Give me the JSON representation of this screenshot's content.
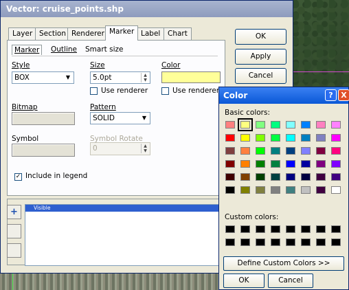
{
  "window": {
    "title": "Vector: cruise_points.shp"
  },
  "tabs": [
    "Layer",
    "Section",
    "Renderer",
    "Marker",
    "Label",
    "Chart"
  ],
  "subtabs": [
    "Marker",
    "Outline",
    "Smart size"
  ],
  "form": {
    "style_label": "Style",
    "style_value": "BOX",
    "size_label": "Size",
    "size_value": "5.0pt",
    "color_label": "Color",
    "color_value": "#ffff99",
    "use_renderer_label": "Use renderer",
    "use_renderer2_label": "Use renderer",
    "bitmap_label": "Bitmap",
    "pattern_label": "Pattern",
    "pattern_value": "SOLID",
    "symbol_label": "Symbol",
    "symbol_rotate_label": "Symbol Rotate",
    "symbol_rotate_value": "0",
    "include_legend_label": "Include in legend",
    "include_legend_checked": true
  },
  "buttons": {
    "ok": "OK",
    "apply": "Apply",
    "cancel": "Cancel"
  },
  "list": {
    "header": "Visible",
    "add_symbol": "+"
  },
  "color_dialog": {
    "title": "Color",
    "help_glyph": "?",
    "close_glyph": "X",
    "basic_label": "Basic colors:",
    "custom_label": "Custom colors:",
    "define_button": "Define Custom Colors >>",
    "ok": "OK",
    "cancel": "Cancel",
    "basic_colors": [
      [
        "#ff8080",
        "#ffff80",
        "#80ff80",
        "#00ff80",
        "#80ffff",
        "#0080ff",
        "#ff80c0",
        "#ff80ff"
      ],
      [
        "#ff0000",
        "#ffff00",
        "#80ff00",
        "#00ff40",
        "#00ffff",
        "#0080c0",
        "#8080c0",
        "#ff00ff"
      ],
      [
        "#804040",
        "#ff8040",
        "#00ff00",
        "#008080",
        "#004080",
        "#8080ff",
        "#800040",
        "#ff0080"
      ],
      [
        "#800000",
        "#ff8000",
        "#008000",
        "#008040",
        "#0000ff",
        "#0000a0",
        "#800080",
        "#8000ff"
      ],
      [
        "#400000",
        "#804000",
        "#004000",
        "#004040",
        "#000080",
        "#000040",
        "#400040",
        "#400080"
      ],
      [
        "#000000",
        "#808000",
        "#808040",
        "#808080",
        "#408080",
        "#c0c0c0",
        "#400040",
        "#ffffff"
      ]
    ],
    "selected_color": "#ffff80"
  }
}
